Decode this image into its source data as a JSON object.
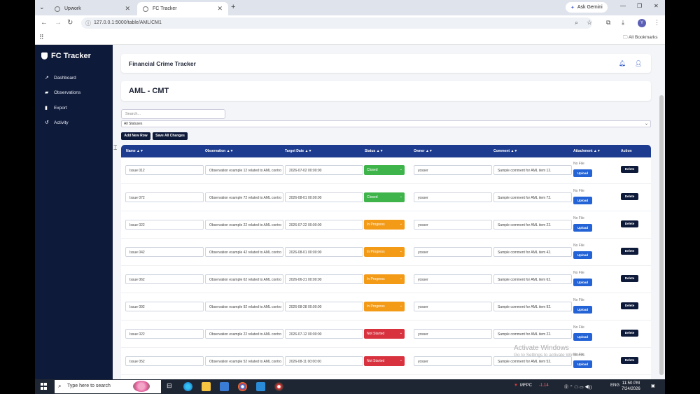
{
  "browser": {
    "tabs": [
      {
        "label": "Upwork"
      },
      {
        "label": "FC Tracker"
      }
    ],
    "ask_gemini": "Ask Gemini",
    "url": "127.0.0.1:5000/table/AML/CM1",
    "all_bookmarks": "All Bookmarks",
    "profile_initial": "Y"
  },
  "app": {
    "brand": "FC Tracker",
    "sidebar": [
      {
        "label": "Dashboard"
      },
      {
        "label": "Observations"
      },
      {
        "label": "Export"
      },
      {
        "label": "Activity"
      }
    ],
    "header_title": "Financial Crime Tracker",
    "page_title": "AML - CMT",
    "search_placeholder": "Search...",
    "status_filter": "All Statuses",
    "add_row": "Add New Row",
    "save_all": "Save All Changes",
    "columns": [
      "Name ▲▼",
      "Observation ▲▼",
      "Target Date ▲▼",
      "Status ▲▼",
      "Owner ▲▼",
      "Comment ▲▼",
      "Attachment ▲▼",
      "Action"
    ],
    "no_file": "No File",
    "upload": "Upload",
    "delete": "Delete",
    "rows": [
      {
        "name": "Issue 012",
        "observation": "Observation example 12 related to AML contro",
        "date": "2026-07-02 00:00:00",
        "status": "Closed",
        "owner": "yosser",
        "comment": "Sample comment for AML item 12."
      },
      {
        "name": "Issue 072",
        "observation": "Observation example 72 related to AML contro",
        "date": "2026-08-01 00:00:00",
        "status": "Closed",
        "owner": "yosser",
        "comment": "Sample comment for AML item 72."
      },
      {
        "name": "Issue 022",
        "observation": "Observation example 22 related to AML contro",
        "date": "2026-07-22 00:00:00",
        "status": "In Progress",
        "owner": "yosser",
        "comment": "Sample comment for AML item 22."
      },
      {
        "name": "Issue 042",
        "observation": "Observation example 42 related to AML contro",
        "date": "2026-08-01 00:00:00",
        "status": "In Progress",
        "owner": "yosser",
        "comment": "Sample comment for AML item 42."
      },
      {
        "name": "Issue 062",
        "observation": "Observation example 62 related to AML contro",
        "date": "2026-06-21 00:00:00",
        "status": "In Progress",
        "owner": "yosser",
        "comment": "Sample comment for AML item 62."
      },
      {
        "name": "Issue 092",
        "observation": "Observation example 92 related to AML contro",
        "date": "2026-08-28 00:00:00",
        "status": "In Progress",
        "owner": "yosser",
        "comment": "Sample comment for AML item 92."
      },
      {
        "name": "Issue 022",
        "observation": "Observation example 22 related to AML contro",
        "date": "2026-07-12 00:00:00",
        "status": "Not Started",
        "owner": "yosser",
        "comment": "Sample comment for AML item 22."
      },
      {
        "name": "Issue 052",
        "observation": "Observation example 52 related to AML contro",
        "date": "2026-08-11 00:00:00",
        "status": "Not Started",
        "owner": "yosser",
        "comment": "Sample comment for AML item 52."
      }
    ],
    "status_colors": {
      "Closed": "#3fb44a",
      "In Progress": "#f39a17",
      "Not Started": "#d8323f"
    }
  },
  "watermark": {
    "line1": "Activate Windows",
    "line2": "Go to Settings to activate Windows."
  },
  "taskbar": {
    "search": "Type here to search",
    "stock_label": "MFPC",
    "stock_change": "-1.14",
    "lang": "ENG",
    "time": "11:50 PM",
    "date": "7/24/2026"
  }
}
